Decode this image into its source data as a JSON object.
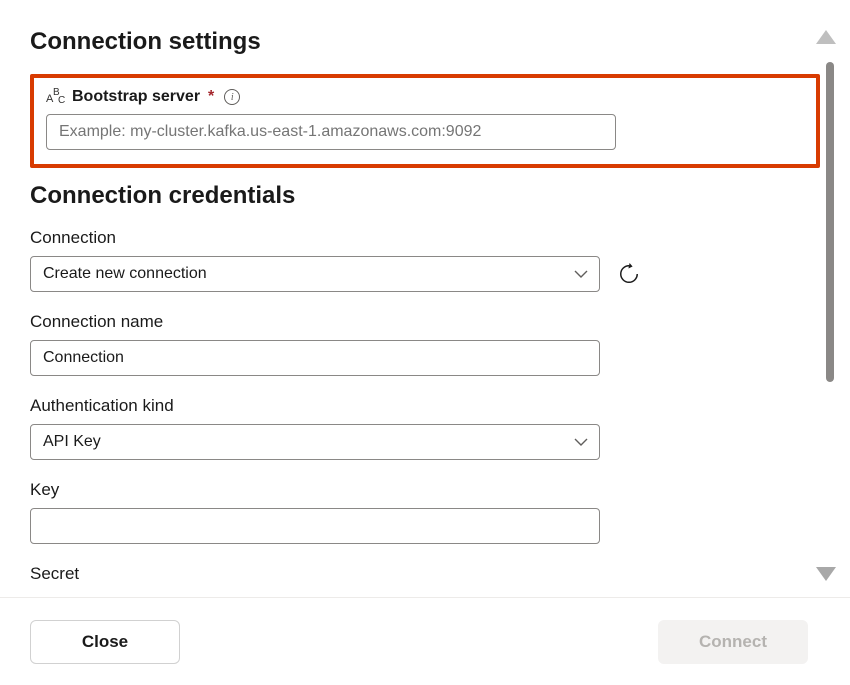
{
  "sections": {
    "connection_settings_heading": "Connection settings",
    "connection_credentials_heading": "Connection credentials"
  },
  "fields": {
    "bootstrap_server": {
      "label": "Bootstrap server",
      "placeholder": "Example: my-cluster.kafka.us-east-1.amazonaws.com:9092",
      "value": ""
    },
    "connection": {
      "label": "Connection",
      "value": "Create new connection"
    },
    "connection_name": {
      "label": "Connection name",
      "value": "Connection"
    },
    "authentication_kind": {
      "label": "Authentication kind",
      "value": "API Key"
    },
    "key": {
      "label": "Key",
      "value": ""
    },
    "secret": {
      "label": "Secret",
      "value": ""
    }
  },
  "footer": {
    "close_label": "Close",
    "connect_label": "Connect"
  }
}
